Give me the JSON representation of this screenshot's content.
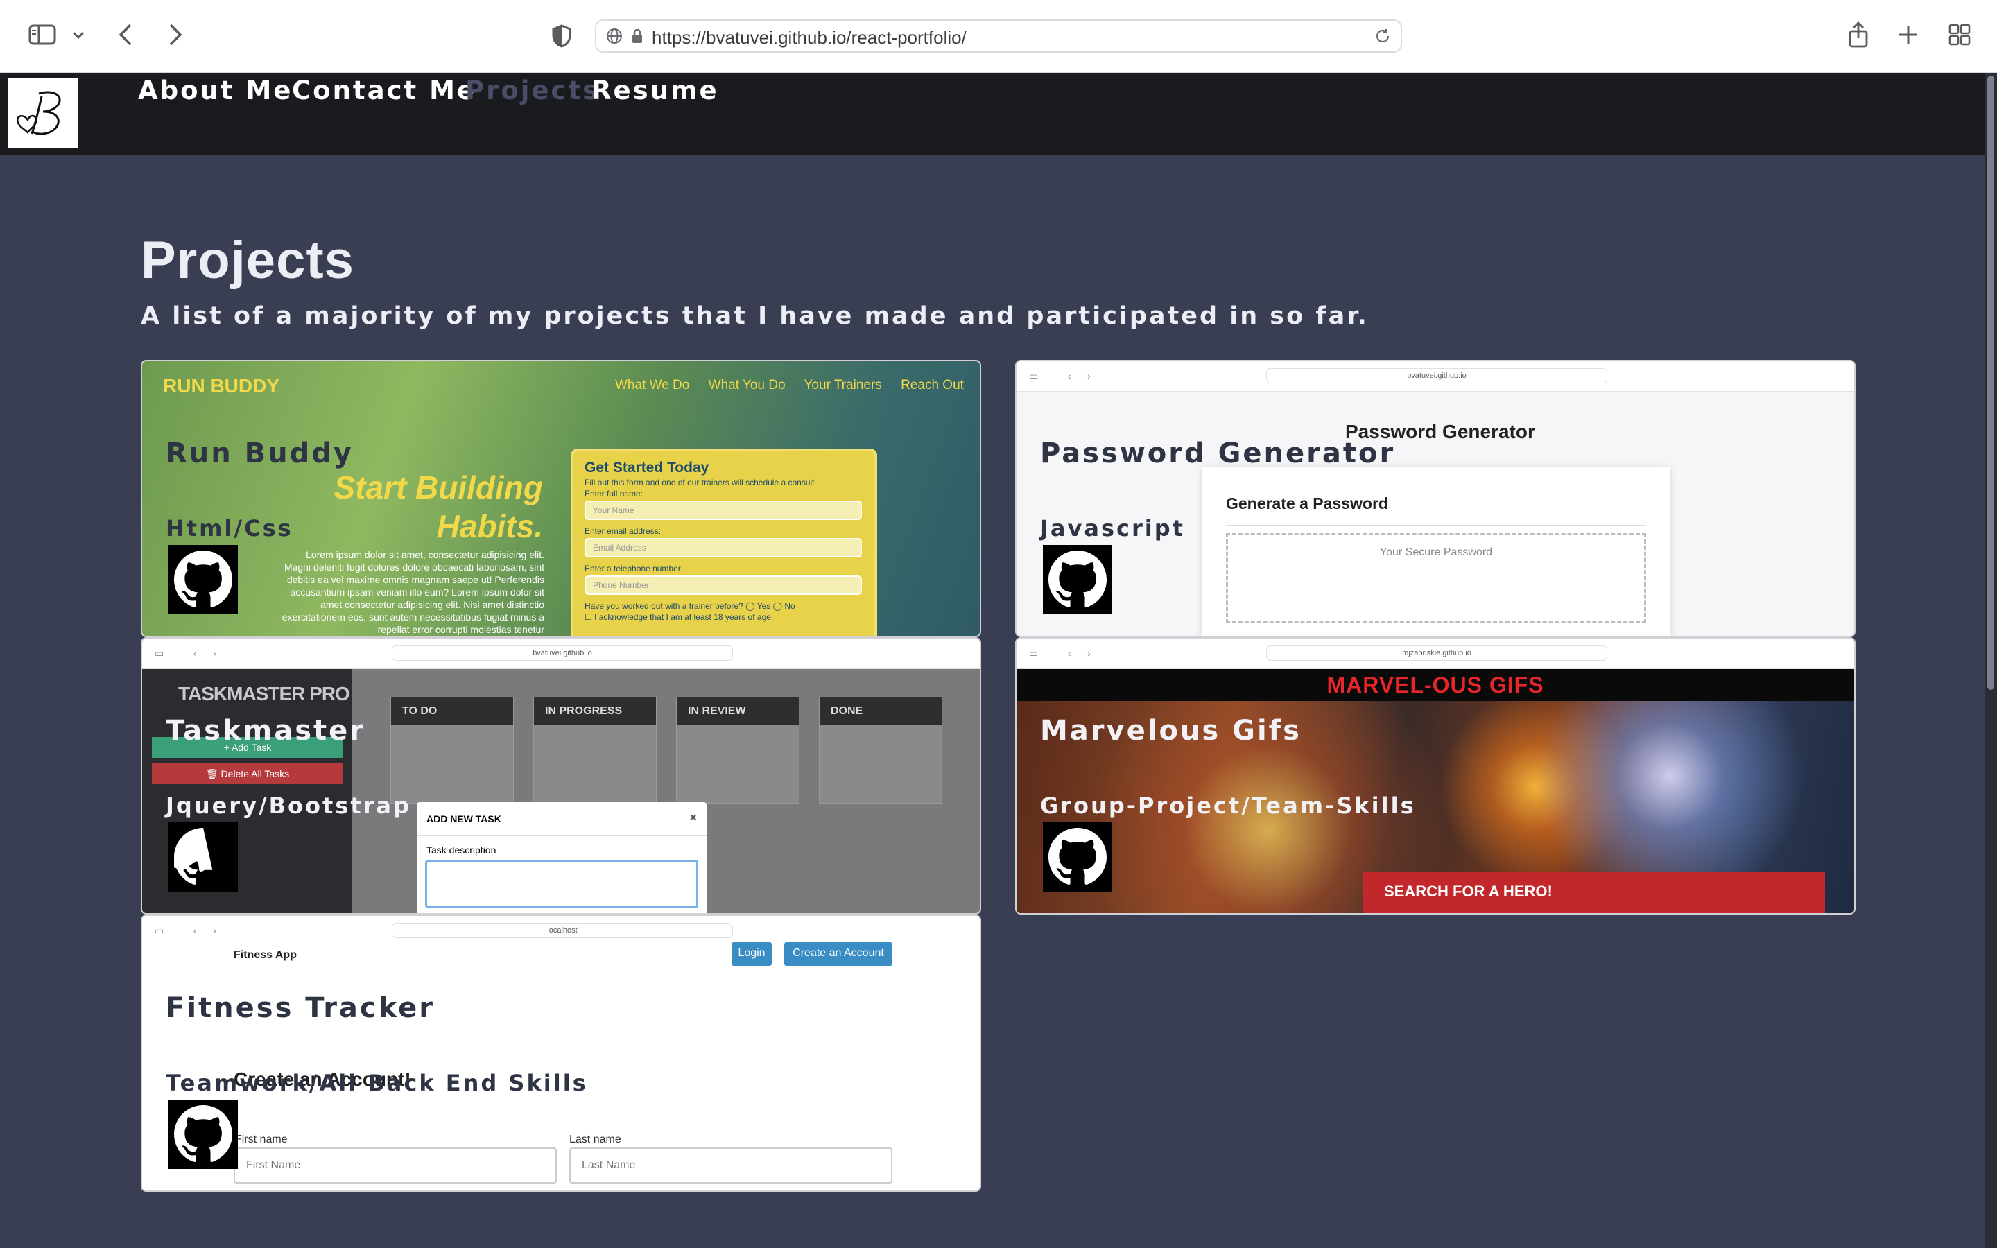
{
  "browser": {
    "url": "https://bvatuvei.github.io/react-portfolio/"
  },
  "nav": {
    "items": [
      "About Me",
      "Contact Me",
      "Projects",
      "Resume"
    ],
    "active": "Projects"
  },
  "page": {
    "title": "Projects",
    "subtitle": "A list of a majority of my projects that I have made and participated in so far."
  },
  "projects": [
    {
      "title": "Run Buddy",
      "tech": "Html/Css",
      "preview": {
        "brand": "RUN BUDDY",
        "links": [
          "What We Do",
          "What You Do",
          "Your Trainers",
          "Reach Out"
        ],
        "hero_line1": "Start Building",
        "hero_line2": "Habits.",
        "lorem": "Lorem ipsum dolor sit amet, consectetur adipisicing elit. Magni deleniti fugit dolores dolore obcaecati laboriosam, sint debitis ea vel maxime omnis magnam saepe ut! Perferendis accusantium ipsam veniam illo eum? Lorem ipsum dolor sit amet consectetur adipisicing elit. Nisi amet distinctio exercitationem eos, sunt autem necessitatibus fugiat minus a repellat error corrupti molestias tenetur",
        "form_title": "Get Started Today",
        "form_sub": "Fill out this form and one of our trainers will schedule a consult",
        "name_label": "Enter full name:",
        "name_placeholder": "Your Name",
        "email_label": "Enter email address:",
        "email_placeholder": "Email Address",
        "phone_label": "Enter a telephone number:",
        "phone_placeholder": "Phone Number",
        "question": "Have you worked out with a trainer before?",
        "yes": "Yes",
        "no": "No",
        "ack": "I acknowledge that I am at least 18 years of age."
      }
    },
    {
      "title": "Password Generator",
      "tech": "Javascript",
      "preview": {
        "mini_url": "bvatuvei.github.io",
        "heading": "Password Generator",
        "panel_title": "Generate a Password",
        "placeholder": "Your Secure Password"
      }
    },
    {
      "title": "Taskmaster",
      "tech": "Jquery/Bootstrap",
      "preview": {
        "mini_url": "bvatuvei.github.io",
        "brand": "TASKMASTER PRO",
        "add_task": "Add Task",
        "delete_all": "Delete All Tasks",
        "columns": [
          "TO DO",
          "IN PROGRESS",
          "IN REVIEW",
          "DONE"
        ],
        "modal_title": "ADD NEW TASK",
        "modal_label": "Task description",
        "close": "×"
      }
    },
    {
      "title": "Marvelous Gifs",
      "tech": "Group-Project/Team-Skills",
      "preview": {
        "mini_url": "mjzabriskie.github.io",
        "banner": "MARVEL-OUS GIFS",
        "search": "SEARCH FOR A HERO!"
      }
    },
    {
      "title": "Fitness Tracker",
      "tech": "Teamwork/All Back End Skills",
      "preview": {
        "mini_url": "localhost",
        "app": "Fitness App",
        "login": "Login",
        "create_btn": "Create an Account",
        "create_heading": "Create an Account!",
        "first_label": "First name",
        "first_placeholder": "First Name",
        "last_label": "Last name",
        "last_placeholder": "Last Name"
      }
    }
  ],
  "colors": {
    "background": "#3a3e52",
    "navbar": "#1a1b1f",
    "nav_active": "#4b4d66",
    "text_light": "#eceef5",
    "card_title": "#2f3444"
  }
}
